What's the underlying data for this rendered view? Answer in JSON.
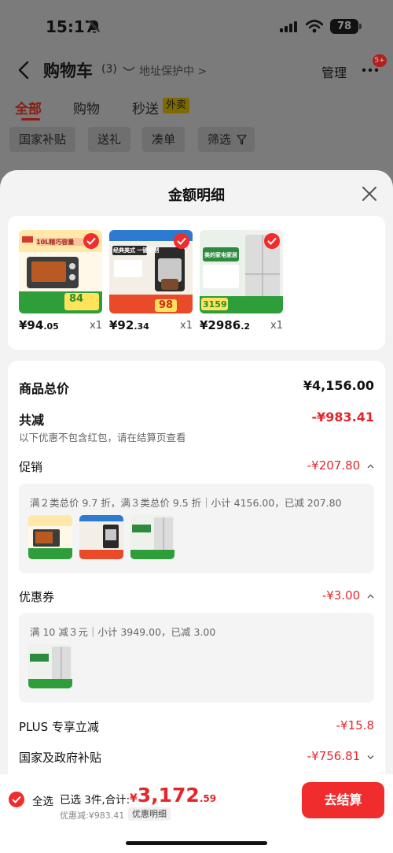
{
  "status_bar": {
    "time": "15:17",
    "battery": "78"
  },
  "nav": {
    "title": "购物车",
    "count": "(3)",
    "address_text": "地址保护中 >",
    "manage": "管理",
    "badge": "5+"
  },
  "tabs": [
    {
      "label": "全部"
    },
    {
      "label": "购物"
    },
    {
      "label": "秒送"
    }
  ],
  "tab_tag": "外卖",
  "filters": [
    {
      "label": "国家补贴"
    },
    {
      "label": "送礼"
    },
    {
      "label": "凑单"
    },
    {
      "label": "筛选"
    }
  ],
  "sheet": {
    "title": "金额明细",
    "products": [
      {
        "price_int": "¥94",
        "price_dec": ".05",
        "qty": "x1",
        "thumb_text": "10L精巧容量",
        "thumb_badge": "84"
      },
      {
        "price_int": "¥92",
        "price_dec": ".34",
        "qty": "x1",
        "thumb_text": "经典美式 一键自制",
        "thumb_badge": "98"
      },
      {
        "price_int": "¥2986",
        "price_dec": ".2",
        "qty": "x1",
        "thumb_text": "美的家电家居",
        "thumb_badge": "3159"
      }
    ],
    "goods_total_label": "商品总价",
    "goods_total_value": "¥4,156.00",
    "total_reduce_label": "共减",
    "total_reduce_value": "-¥983.41",
    "reduce_hint": "以下优惠不包含红包，请在结算页查看",
    "promo": {
      "label": "促销",
      "value": "-¥207.80",
      "desc": "满２类总价 9.7 折，满３类总价 9.5 折｜小计 4156.00，已减 207.80"
    },
    "coupon": {
      "label": "优惠券",
      "value": "-¥3.00",
      "desc": "满 10 减３元｜小计 3949.00，已减 3.00"
    },
    "plus": {
      "label": "PLUS 专享立减",
      "value": "-¥15.8"
    },
    "subsidy": {
      "label": "国家及政府补贴",
      "value": "-¥756.81"
    }
  },
  "bottom_bar": {
    "select_all": "全选",
    "selected": "已选 3件,合计:",
    "currency": "¥",
    "total_int": "3,172",
    "total_dec": ".59",
    "discount": "优惠减:¥983.41",
    "detail_link": "优惠明细",
    "checkout": "去结算"
  },
  "colors": {
    "accent_red": "#f12c2c",
    "price_red": "#e4262b"
  },
  "icons": [
    "bell-slash-icon",
    "signal-icon",
    "wifi-icon",
    "back-icon",
    "shield-icon",
    "more-icon",
    "filter-icon",
    "close-icon",
    "check-icon",
    "caret-up-icon",
    "caret-down-icon"
  ]
}
